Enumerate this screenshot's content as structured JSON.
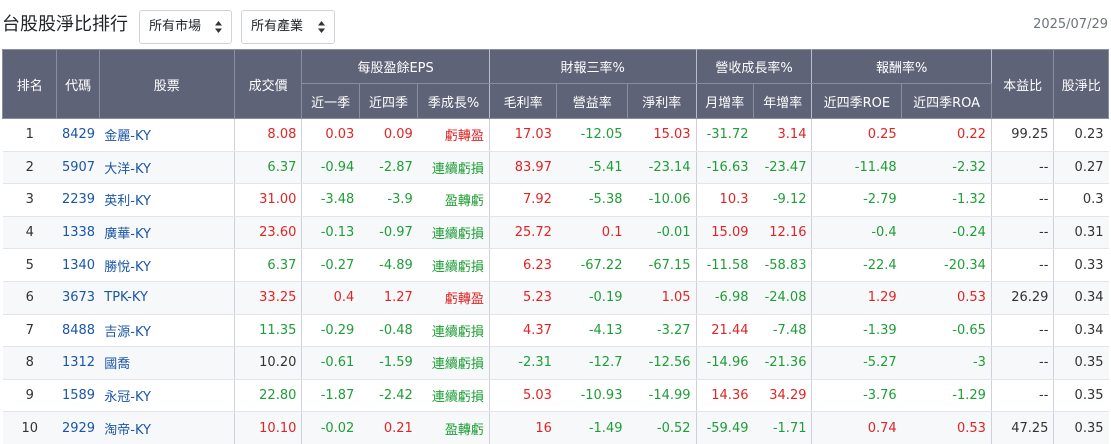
{
  "page": {
    "title": "台股股淨比排行",
    "date": "2025/07/29"
  },
  "filters": {
    "market": {
      "value": "所有市場"
    },
    "industry": {
      "value": "所有產業"
    }
  },
  "colors": {
    "header_bg": "#5f6378",
    "positive": "#e02424",
    "negative": "#1e9e36",
    "link": "#1a56a8"
  },
  "table": {
    "group_headers": {
      "rank": "排名",
      "code": "代碼",
      "stock": "股票",
      "price": "成交價",
      "eps": "每股盈餘EPS",
      "finance": "財報三率%",
      "revenue": "營收成長率%",
      "return": "報酬率%",
      "pe": "本益比",
      "pb": "股淨比"
    },
    "sub_headers": {
      "eps_q": "近一季",
      "eps_4q": "近四季",
      "eps_growth": "季成長%",
      "gross": "毛利率",
      "operating": "營益率",
      "net": "淨利率",
      "mom": "月增率",
      "yoy": "年增率",
      "roe": "近四季ROE",
      "roa": "近四季ROA"
    },
    "rows": [
      {
        "rank": "1",
        "code": "8429",
        "name": "金麗-KY",
        "price": "8.08",
        "eps_q": "0.03",
        "eps_4q": "0.09",
        "eps_growth": "虧轉盈",
        "gross": "17.03",
        "operating": "-12.05",
        "net": "15.03",
        "mom": "-31.72",
        "yoy": "3.14",
        "roe": "0.25",
        "roa": "0.22",
        "pe": "99.25",
        "pb": "0.23"
      },
      {
        "rank": "2",
        "code": "5907",
        "name": "大洋-KY",
        "price": "6.37",
        "eps_q": "-0.94",
        "eps_4q": "-2.87",
        "eps_growth": "連續虧損",
        "gross": "83.97",
        "operating": "-5.41",
        "net": "-23.14",
        "mom": "-16.63",
        "yoy": "-23.47",
        "roe": "-11.48",
        "roa": "-2.32",
        "pe": "--",
        "pb": "0.27"
      },
      {
        "rank": "3",
        "code": "2239",
        "name": "英利-KY",
        "price": "31.00",
        "eps_q": "-3.48",
        "eps_4q": "-3.9",
        "eps_growth": "盈轉虧",
        "gross": "7.92",
        "operating": "-5.38",
        "net": "-10.06",
        "mom": "10.3",
        "yoy": "-9.12",
        "roe": "-2.79",
        "roa": "-1.32",
        "pe": "--",
        "pb": "0.3"
      },
      {
        "rank": "4",
        "code": "1338",
        "name": "廣華-KY",
        "price": "23.60",
        "eps_q": "-0.13",
        "eps_4q": "-0.97",
        "eps_growth": "連續虧損",
        "gross": "25.72",
        "operating": "0.1",
        "net": "-0.01",
        "mom": "15.09",
        "yoy": "12.16",
        "roe": "-0.4",
        "roa": "-0.24",
        "pe": "--",
        "pb": "0.31"
      },
      {
        "rank": "5",
        "code": "1340",
        "name": "勝悅-KY",
        "price": "6.37",
        "eps_q": "-0.27",
        "eps_4q": "-4.89",
        "eps_growth": "連續虧損",
        "gross": "6.23",
        "operating": "-67.22",
        "net": "-67.15",
        "mom": "-11.58",
        "yoy": "-58.83",
        "roe": "-22.4",
        "roa": "-20.34",
        "pe": "--",
        "pb": "0.33"
      },
      {
        "rank": "6",
        "code": "3673",
        "name": "TPK-KY",
        "price": "33.25",
        "eps_q": "0.4",
        "eps_4q": "1.27",
        "eps_growth": "虧轉盈",
        "gross": "5.23",
        "operating": "-0.19",
        "net": "1.05",
        "mom": "-6.98",
        "yoy": "-24.08",
        "roe": "1.29",
        "roa": "0.53",
        "pe": "26.29",
        "pb": "0.34"
      },
      {
        "rank": "7",
        "code": "8488",
        "name": "吉源-KY",
        "price": "11.35",
        "eps_q": "-0.29",
        "eps_4q": "-0.48",
        "eps_growth": "連續虧損",
        "gross": "4.37",
        "operating": "-4.13",
        "net": "-3.27",
        "mom": "21.44",
        "yoy": "-7.48",
        "roe": "-1.39",
        "roa": "-0.65",
        "pe": "--",
        "pb": "0.34"
      },
      {
        "rank": "8",
        "code": "1312",
        "name": "國喬",
        "price": "10.20",
        "eps_q": "-0.61",
        "eps_4q": "-1.59",
        "eps_growth": "連續虧損",
        "gross": "-2.31",
        "operating": "-12.7",
        "net": "-12.56",
        "mom": "-14.96",
        "yoy": "-21.36",
        "roe": "-5.27",
        "roa": "-3",
        "pe": "--",
        "pb": "0.35"
      },
      {
        "rank": "9",
        "code": "1589",
        "name": "永冠-KY",
        "price": "22.80",
        "eps_q": "-1.87",
        "eps_4q": "-2.42",
        "eps_growth": "連續虧損",
        "gross": "5.03",
        "operating": "-10.93",
        "net": "-14.99",
        "mom": "14.36",
        "yoy": "34.29",
        "roe": "-3.76",
        "roa": "-1.29",
        "pe": "--",
        "pb": "0.35"
      },
      {
        "rank": "10",
        "code": "2929",
        "name": "淘帝-KY",
        "price": "10.10",
        "eps_q": "-0.02",
        "eps_4q": "0.21",
        "eps_growth": "盈轉虧",
        "gross": "16",
        "operating": "-1.49",
        "net": "-0.52",
        "mom": "-59.49",
        "yoy": "-1.71",
        "roe": "0.74",
        "roa": "0.53",
        "pe": "47.25",
        "pb": "0.35"
      }
    ]
  }
}
